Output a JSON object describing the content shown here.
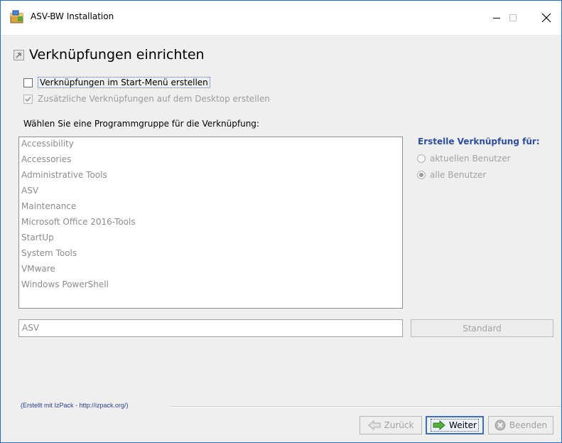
{
  "window": {
    "title": "ASV-BW Installation",
    "accent_color": "#1f6fd0",
    "controls": {
      "minimize": "minimize-icon",
      "maximize": "maximize-icon",
      "close": "close-icon"
    }
  },
  "page": {
    "title": "Verknüpfungen einrichten",
    "checkboxes": [
      {
        "label": "Verknüpfungen im Start-Menü erstellen",
        "checked": false,
        "enabled": true
      },
      {
        "label": "Zusätzliche Verknüpfungen auf dem Desktop erstellen",
        "checked": true,
        "enabled": false
      }
    ],
    "program_group_prompt": "Wählen Sie eine Programmgruppe für die Verknüpfung:",
    "program_groups": [
      "Accessibility",
      "Accessories",
      "Administrative Tools",
      "ASV",
      "Maintenance",
      "Microsoft Office 2016-Tools",
      "StartUp",
      "System Tools",
      "VMware",
      "Windows PowerShell"
    ],
    "shortcut_for": {
      "title": "Erstelle Verknüpfung für:",
      "options": [
        {
          "label": "aktuellen Benutzer",
          "selected": false
        },
        {
          "label": "alle Benutzer",
          "selected": true
        }
      ]
    },
    "group_name_value": "ASV",
    "default_button_label": "Standard"
  },
  "footer": {
    "credit": "(Erstellt mit IzPack - http://izpack.org/)",
    "back_label": "Zurück",
    "next_label": "Weiter",
    "quit_label": "Beenden"
  }
}
